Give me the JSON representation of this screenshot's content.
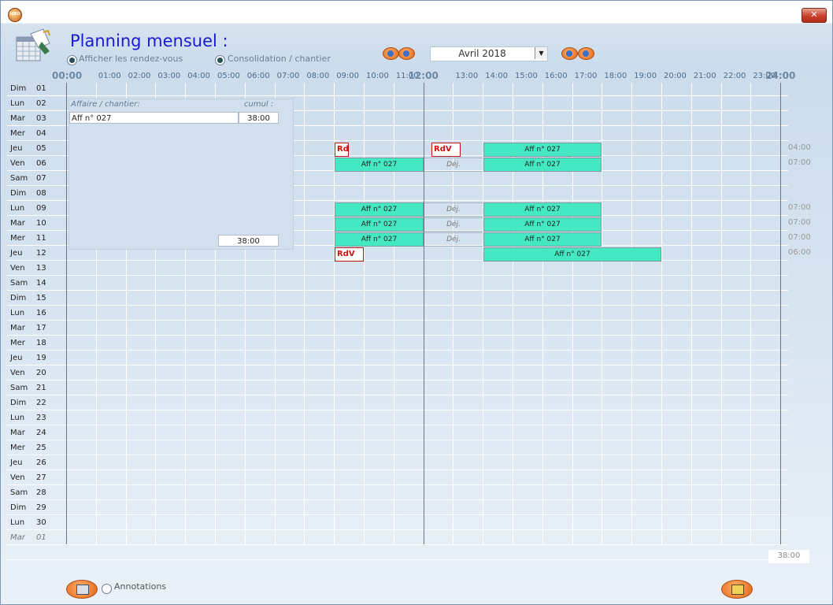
{
  "window": {
    "title_bar_icon": "app-logo-icon",
    "logo_text": "ISEO",
    "close_icon": "close-icon"
  },
  "header": {
    "title": "Planning mensuel :",
    "icon": "calendar-icon"
  },
  "options": {
    "show_appointments": "Afficher les rendez-vous",
    "consolidation": "Consolidation / chantier"
  },
  "navigation": {
    "month": "Avril 2018",
    "prev_icons": [
      "double-left-arrow-icon",
      "left-arrow-icon"
    ],
    "next_icons": [
      "right-arrow-icon",
      "double-right-arrow-icon"
    ]
  },
  "hours": [
    "00:00",
    "01:00",
    "02:00",
    "03:00",
    "04:00",
    "05:00",
    "06:00",
    "07:00",
    "08:00",
    "09:00",
    "10:00",
    "11:00",
    "12:00",
    "13:00",
    "14:00",
    "15:00",
    "16:00",
    "17:00",
    "18:00",
    "19:00",
    "20:00",
    "21:00",
    "22:00",
    "23:00",
    "24:00"
  ],
  "days": [
    {
      "name": "Dim",
      "num": "01"
    },
    {
      "name": "Lun",
      "num": "02"
    },
    {
      "name": "Mar",
      "num": "03"
    },
    {
      "name": "Mer",
      "num": "04"
    },
    {
      "name": "Jeu",
      "num": "05"
    },
    {
      "name": "Ven",
      "num": "06"
    },
    {
      "name": "Sam",
      "num": "07"
    },
    {
      "name": "Dim",
      "num": "08"
    },
    {
      "name": "Lun",
      "num": "09"
    },
    {
      "name": "Mar",
      "num": "10"
    },
    {
      "name": "Mer",
      "num": "11"
    },
    {
      "name": "Jeu",
      "num": "12"
    },
    {
      "name": "Ven",
      "num": "13"
    },
    {
      "name": "Sam",
      "num": "14"
    },
    {
      "name": "Dim",
      "num": "15"
    },
    {
      "name": "Lun",
      "num": "16"
    },
    {
      "name": "Mar",
      "num": "17"
    },
    {
      "name": "Mer",
      "num": "18"
    },
    {
      "name": "Jeu",
      "num": "19"
    },
    {
      "name": "Ven",
      "num": "20"
    },
    {
      "name": "Sam",
      "num": "21"
    },
    {
      "name": "Dim",
      "num": "22"
    },
    {
      "name": "Lun",
      "num": "23"
    },
    {
      "name": "Mar",
      "num": "24"
    },
    {
      "name": "Mer",
      "num": "25"
    },
    {
      "name": "Jeu",
      "num": "26"
    },
    {
      "name": "Ven",
      "num": "27"
    },
    {
      "name": "Sam",
      "num": "28"
    },
    {
      "name": "Dim",
      "num": "29"
    },
    {
      "name": "Lun",
      "num": "30"
    },
    {
      "name": "Mar",
      "num": "01"
    }
  ],
  "consolidation_panel": {
    "col_affaire": "Affaire / chantier:",
    "col_cumul": "cumul :",
    "rows": [
      {
        "affaire": "Aff n° 027",
        "cumul": "38:00"
      }
    ],
    "total": "38:00"
  },
  "events": [
    {
      "day": 5,
      "start": 9.0,
      "end": 9.5,
      "type": "rdv",
      "label": "RdV"
    },
    {
      "day": 5,
      "start": 12.25,
      "end": 13.25,
      "type": "rdv",
      "label": "RdV"
    },
    {
      "day": 5,
      "start": 14.0,
      "end": 18.0,
      "type": "aff",
      "label": "Aff n° 027"
    },
    {
      "day": 6,
      "start": 9.0,
      "end": 12.0,
      "type": "aff",
      "label": "Aff n° 027"
    },
    {
      "day": 6,
      "start": 12.0,
      "end": 14.0,
      "type": "dej",
      "label": "Déj."
    },
    {
      "day": 6,
      "start": 14.0,
      "end": 18.0,
      "type": "aff",
      "label": "Aff n° 027"
    },
    {
      "day": 9,
      "start": 9.0,
      "end": 12.0,
      "type": "aff",
      "label": "Aff n° 027"
    },
    {
      "day": 9,
      "start": 12.0,
      "end": 14.0,
      "type": "dej",
      "label": "Déj."
    },
    {
      "day": 9,
      "start": 14.0,
      "end": 18.0,
      "type": "aff",
      "label": "Aff n° 027"
    },
    {
      "day": 10,
      "start": 9.0,
      "end": 12.0,
      "type": "aff",
      "label": "Aff n° 027"
    },
    {
      "day": 10,
      "start": 12.0,
      "end": 14.0,
      "type": "dej",
      "label": "Déj."
    },
    {
      "day": 10,
      "start": 14.0,
      "end": 18.0,
      "type": "aff",
      "label": "Aff n° 027"
    },
    {
      "day": 11,
      "start": 9.0,
      "end": 12.0,
      "type": "aff",
      "label": "Aff n° 027"
    },
    {
      "day": 11,
      "start": 12.0,
      "end": 14.0,
      "type": "dej",
      "label": "Déj."
    },
    {
      "day": 11,
      "start": 14.0,
      "end": 18.0,
      "type": "aff",
      "label": "Aff n° 027"
    },
    {
      "day": 12,
      "start": 9.0,
      "end": 10.0,
      "type": "rdv",
      "label": "RdV"
    },
    {
      "day": 12,
      "start": 14.0,
      "end": 20.0,
      "type": "aff",
      "label": "Aff n° 027"
    }
  ],
  "day_totals": [
    {
      "day": 5,
      "value": "04:00"
    },
    {
      "day": 6,
      "value": "07:00"
    },
    {
      "day": 9,
      "value": "07:00"
    },
    {
      "day": 10,
      "value": "07:00"
    },
    {
      "day": 11,
      "value": "07:00"
    },
    {
      "day": 12,
      "value": "06:00"
    }
  ],
  "grand_total": "38:00",
  "footer": {
    "annotations": "Annotations",
    "print_icon": "printer-icon",
    "exit_icon": "exit-door-icon"
  }
}
